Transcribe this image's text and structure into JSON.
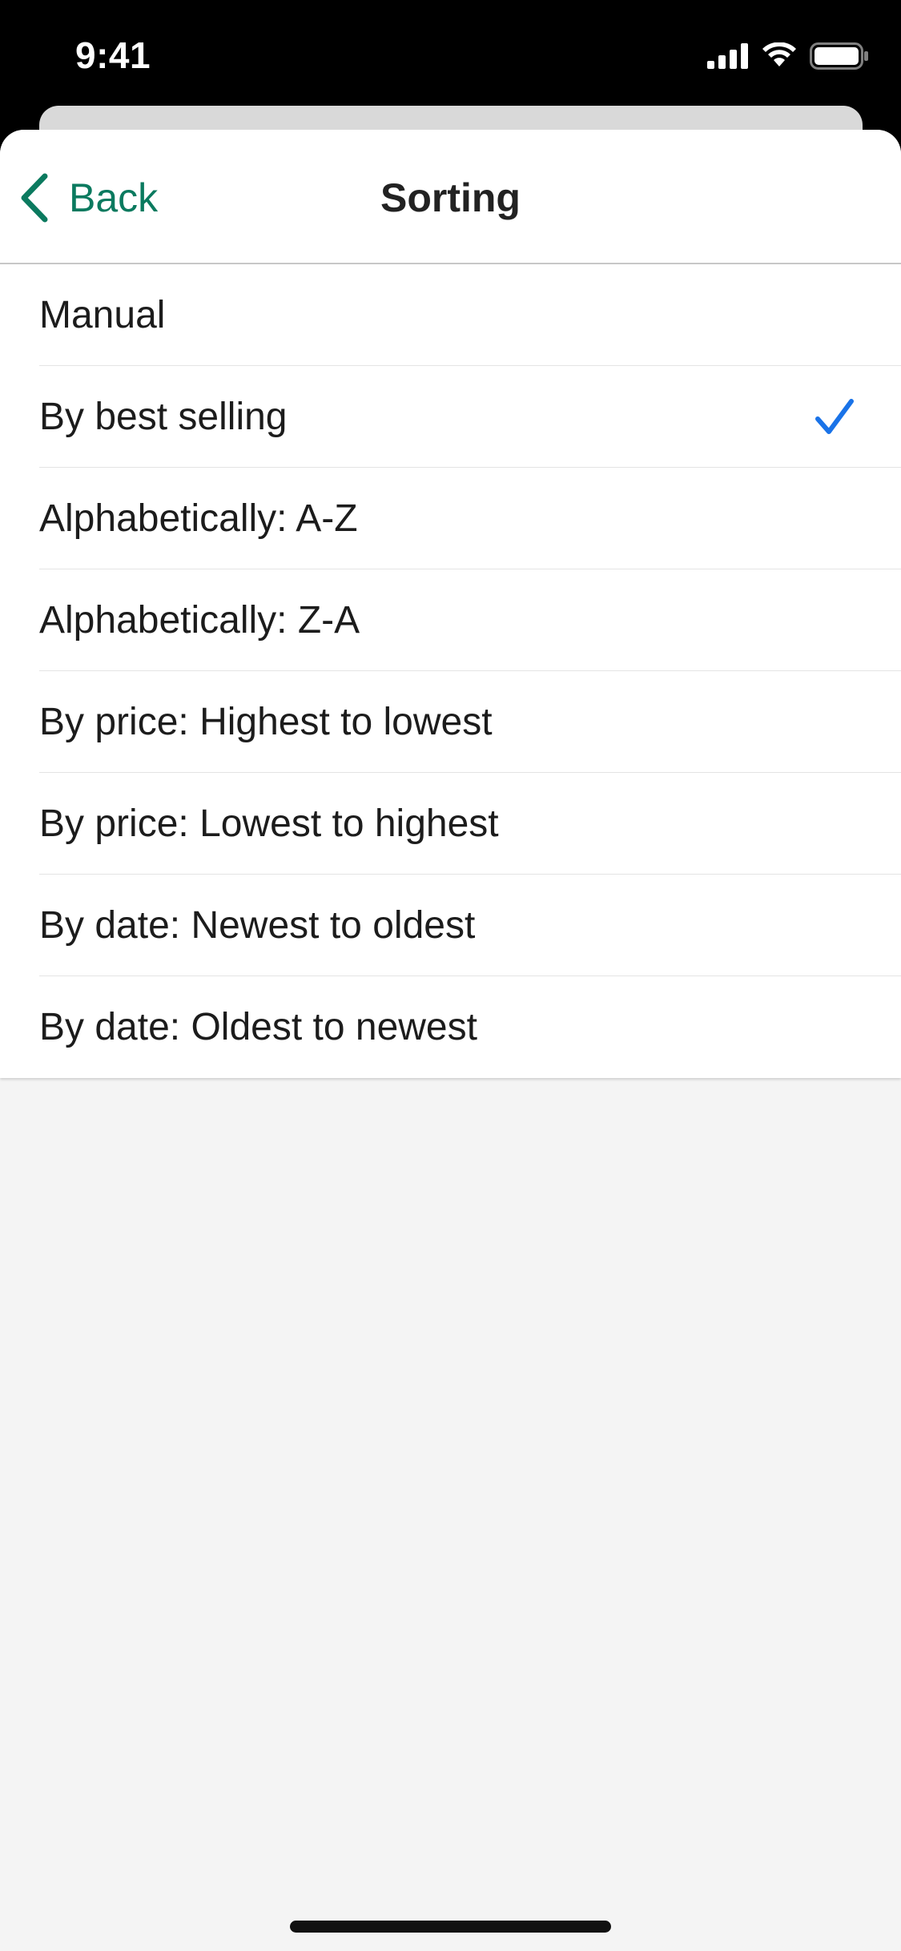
{
  "status_bar": {
    "time": "9:41",
    "icons": [
      "signal-icon",
      "wifi-icon",
      "battery-icon"
    ]
  },
  "nav": {
    "back_label": "Back",
    "title": "Sorting"
  },
  "options": [
    {
      "label": "Manual",
      "selected": false
    },
    {
      "label": "By best selling",
      "selected": true
    },
    {
      "label": "Alphabetically: A-Z",
      "selected": false
    },
    {
      "label": "Alphabetically: Z-A",
      "selected": false
    },
    {
      "label": "By price: Highest to lowest",
      "selected": false
    },
    {
      "label": "By price: Lowest to highest",
      "selected": false
    },
    {
      "label": "By date: Newest to oldest",
      "selected": false
    },
    {
      "label": "By date: Oldest to newest",
      "selected": false
    }
  ],
  "colors": {
    "accent_back": "#0b7a5f",
    "checkmark": "#1a73e8",
    "background": "#f4f4f4"
  }
}
